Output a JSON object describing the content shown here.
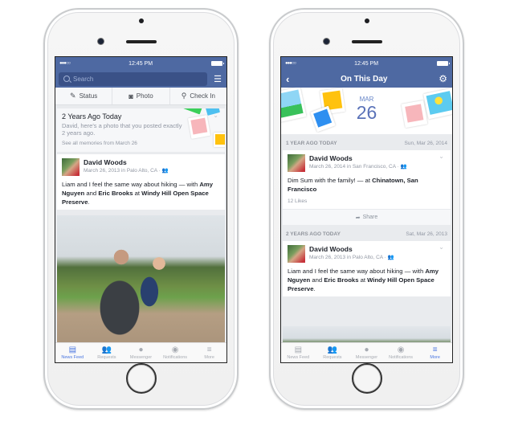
{
  "left_phone": {
    "status_bar": {
      "time": "12:45 PM",
      "signal": "●●●○○"
    },
    "search": {
      "placeholder": "Search"
    },
    "composer": [
      {
        "label": "Status",
        "icon": "edit-icon"
      },
      {
        "label": "Photo",
        "icon": "camera-icon"
      },
      {
        "label": "Check In",
        "icon": "location-pin-icon"
      }
    ],
    "memory": {
      "title": "2 Years Ago Today",
      "body": "David, here's a photo that you posted exactly 2 years ago.",
      "link": "See all memories from March 26"
    },
    "post": {
      "author": "David Woods",
      "meta": "March 26, 2013 in Palo Alto, CA · ",
      "text_prefix": "Liam and I feel the same way about hiking — with ",
      "tag1": "Amy Nguyen",
      "and": " and ",
      "tag2": "Eric Brooks",
      "at": " at ",
      "place": "Windy Hill Open Space Preserve",
      "end": "."
    },
    "tabbar": [
      {
        "label": "News Feed",
        "icon": "news-feed-icon",
        "active": true
      },
      {
        "label": "Requests",
        "icon": "friend-requests-icon",
        "active": false
      },
      {
        "label": "Messenger",
        "icon": "messenger-icon",
        "active": false
      },
      {
        "label": "Notifications",
        "icon": "globe-icon",
        "active": false
      },
      {
        "label": "More",
        "icon": "menu-icon",
        "active": false
      }
    ]
  },
  "right_phone": {
    "status_bar": {
      "time": "12:45 PM",
      "signal": "●●●○○"
    },
    "nav": {
      "title": "On This Day",
      "back": "‹",
      "settings": "⚙"
    },
    "hero": {
      "month": "MAR",
      "day": "26"
    },
    "sections": [
      {
        "label": "1 YEAR AGO TODAY",
        "date": "Sun, Mar 26, 2014",
        "post": {
          "author": "David Woods",
          "meta": "March 26, 2014 in San Francisco, CA · ",
          "text_prefix": "Dim Sum with the family! — at ",
          "place": "Chinatown, San Francisco",
          "likes": "12 Likes",
          "share": "Share"
        }
      },
      {
        "label": "2 YEARS AGO TODAY",
        "date": "Sat, Mar 26, 2013",
        "post": {
          "author": "David Woods",
          "meta": "March 26, 2013 in Palo Alto, CA · ",
          "text_prefix": "Liam and I feel the same way about hiking — with ",
          "tag1": "Amy Nguyen",
          "and": " and ",
          "tag2": "Eric Brooks",
          "at": " at ",
          "place": "Windy Hill Open Space Preserve",
          "end": "."
        }
      }
    ],
    "tabbar": [
      {
        "label": "News Feed",
        "icon": "news-feed-icon",
        "active": false
      },
      {
        "label": "Requests",
        "icon": "friend-requests-icon",
        "active": false
      },
      {
        "label": "Messenger",
        "icon": "messenger-icon",
        "active": false
      },
      {
        "label": "Notifications",
        "icon": "globe-icon",
        "active": false
      },
      {
        "label": "More",
        "icon": "menu-icon",
        "active": true
      }
    ]
  },
  "colors": {
    "facebook_blue": "#4e69a2",
    "active_tab": "#4a76e0",
    "feed_background": "#e9ebee"
  }
}
